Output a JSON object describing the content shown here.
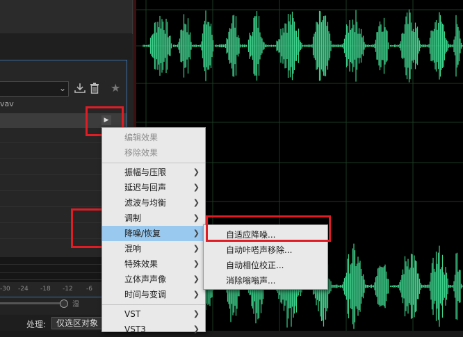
{
  "left_panel": {
    "file_suffix": "vav",
    "meter_scale": [
      "-30",
      "-24",
      "-18",
      "-12",
      "-6",
      "0"
    ],
    "mix_label": "湿",
    "process_label": "处理:",
    "process_value": "仅选区对象"
  },
  "effects_menu": {
    "edit_effect": "编辑效果",
    "remove_effect": "移除效果",
    "items": [
      {
        "label": "振幅与压限"
      },
      {
        "label": "延迟与回声"
      },
      {
        "label": "滤波与均衡"
      },
      {
        "label": "调制"
      },
      {
        "label": "降噪/恢复"
      },
      {
        "label": "混响"
      },
      {
        "label": "特殊效果"
      },
      {
        "label": "立体声声像"
      },
      {
        "label": "时间与变调"
      },
      {
        "label": "VST"
      },
      {
        "label": "VST3"
      }
    ],
    "active_item": "降噪/恢复"
  },
  "noise_submenu": {
    "items": [
      {
        "label": "自适应降噪..."
      },
      {
        "label": "自动咔嗒声移除..."
      },
      {
        "label": "自动相位校正..."
      },
      {
        "label": "消除嗡嗡声..."
      }
    ]
  },
  "colors": {
    "waveform": "#3ed18c",
    "highlight": "#e01c24",
    "menu_active": "#99c9ef"
  }
}
